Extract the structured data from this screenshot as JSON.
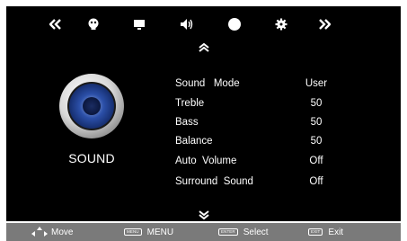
{
  "menu": {
    "category_label": "SOUND",
    "items": [
      {
        "label": "Sound   Mode",
        "value": "User"
      },
      {
        "label": "Treble",
        "value": "50"
      },
      {
        "label": "Bass",
        "value": "50"
      },
      {
        "label": "Balance",
        "value": "50"
      },
      {
        "label": "Auto  Volume",
        "value": "Off"
      },
      {
        "label": "Surround  Sound",
        "value": "Off"
      }
    ]
  },
  "top_icons": [
    "double-chevron-left-icon",
    "picture-icon",
    "screen-icon",
    "speaker-icon",
    "circle-icon",
    "gear-icon",
    "double-chevron-right-icon"
  ],
  "bottom": {
    "move_label": "Move",
    "menu_key": "MENU",
    "menu_label": "MENU",
    "select_key": "ENTER",
    "select_label": "Select",
    "exit_key": "EXIT",
    "exit_label": "Exit"
  },
  "colors": {
    "background": "#000000",
    "text": "#ffffff",
    "bottombar": "#7a7a7a",
    "speaker_ring": "#d8d8d8",
    "speaker_cone": "#2b4fa8"
  }
}
